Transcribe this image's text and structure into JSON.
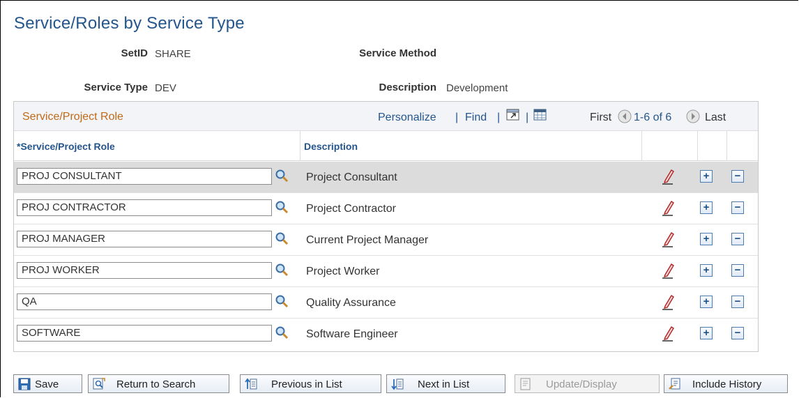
{
  "page": {
    "title": "Service/Roles by Service Type"
  },
  "fields": {
    "setid_label": "SetID",
    "setid_value": "SHARE",
    "service_method_label": "Service Method",
    "service_type_label": "Service Type",
    "service_type_value": "DEV",
    "description_label": "Description",
    "description_value": "Development"
  },
  "grid": {
    "title": "Service/Project Role",
    "personalize": "Personalize",
    "find": "Find",
    "first": "First",
    "range": "1-6 of 6",
    "last": "Last",
    "columns": {
      "role": "*Service/Project Role",
      "description": "Description"
    },
    "rows": [
      {
        "role": "PROJ CONSULTANT",
        "description": "Project Consultant"
      },
      {
        "role": "PROJ CONTRACTOR",
        "description": "Project Contractor"
      },
      {
        "role": "PROJ MANAGER",
        "description": "Current Project Manager"
      },
      {
        "role": "PROJ WORKER",
        "description": "Project Worker"
      },
      {
        "role": "QA",
        "description": "Quality Assurance"
      },
      {
        "role": "SOFTWARE",
        "description": "Software Engineer"
      }
    ]
  },
  "toolbar": {
    "save": "Save",
    "return_to_search": "Return to Search",
    "previous_in_list": "Previous in List",
    "next_in_list": "Next in List",
    "update_display": "Update/Display",
    "include_history": "Include History"
  },
  "colors": {
    "title": "#24558c",
    "grid_title": "#c06a18",
    "selected_row": "#dcdcdc"
  },
  "icons": [
    "lookup-icon",
    "edit-pencil-icon",
    "add-row-icon",
    "delete-row-icon",
    "zoom-icon",
    "download-icon",
    "nav-prev-icon",
    "nav-next-icon",
    "save-icon",
    "return-search-icon",
    "previous-list-icon",
    "next-list-icon",
    "update-display-icon",
    "include-history-icon"
  ]
}
